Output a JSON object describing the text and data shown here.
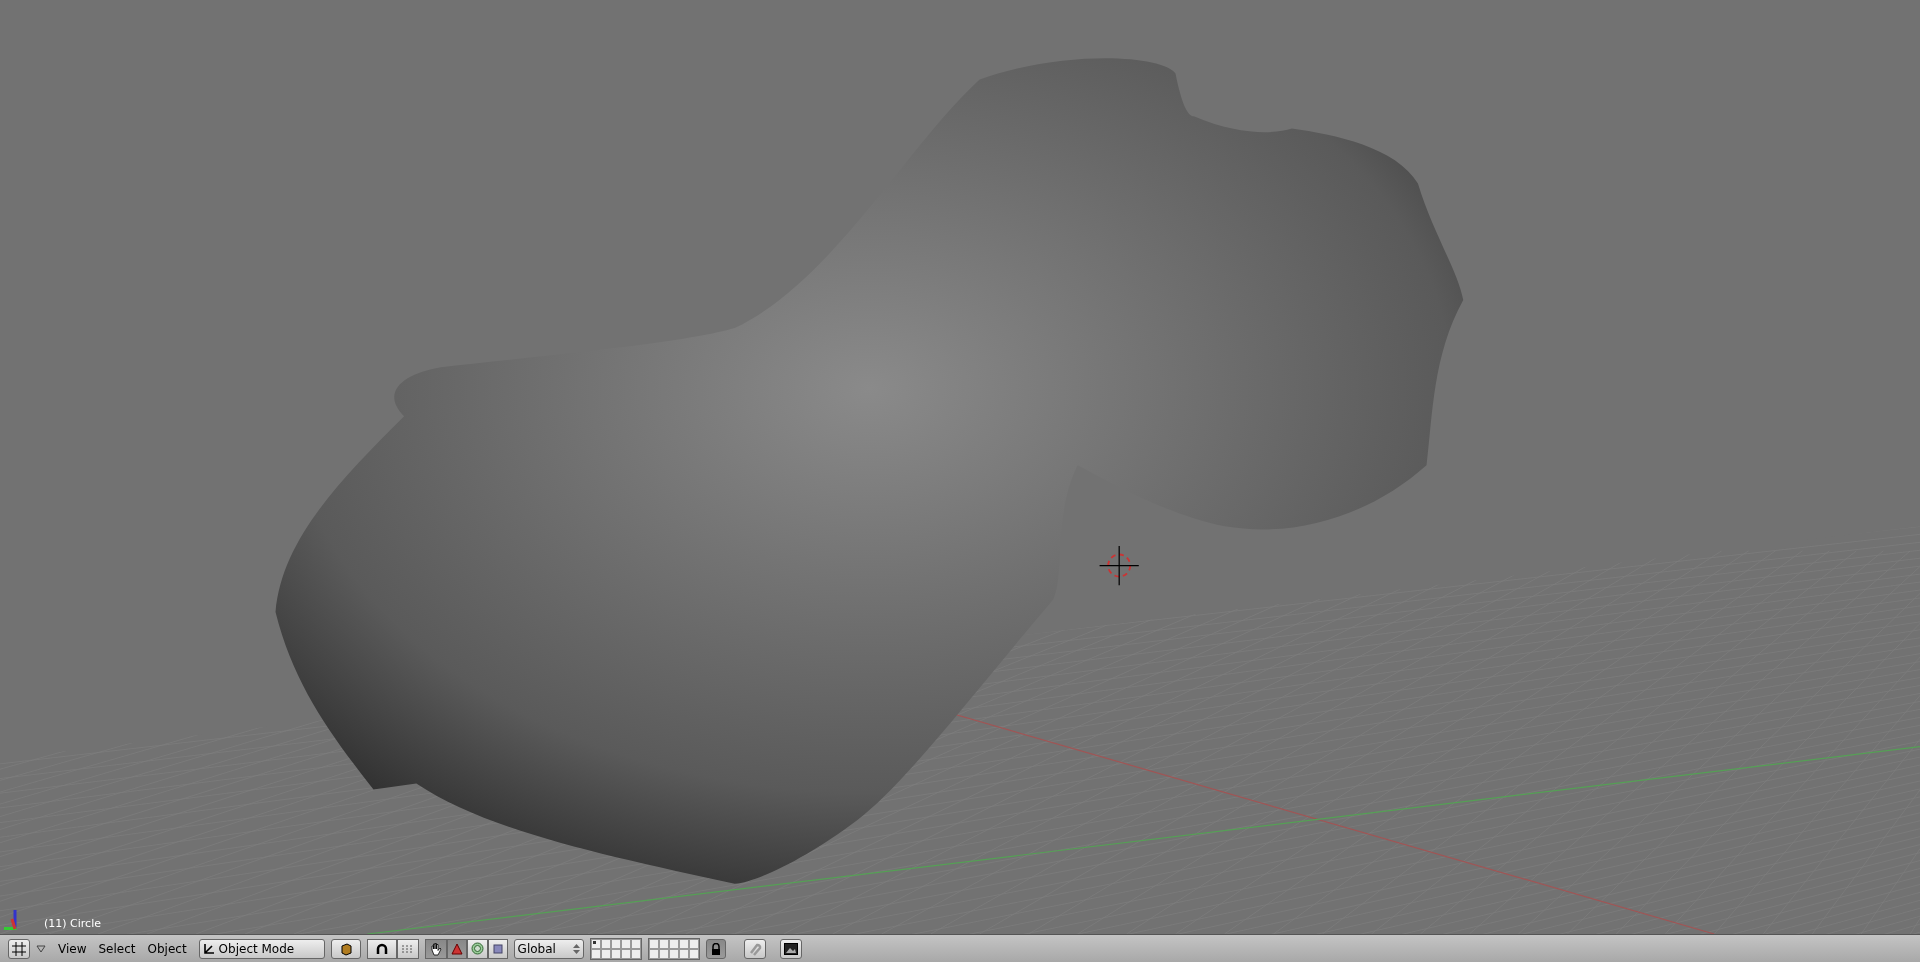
{
  "viewport": {
    "object_label": "(11) Circle"
  },
  "header": {
    "menus": [
      "View",
      "Select",
      "Object"
    ],
    "mode": "Object Mode",
    "manipulators": [
      {
        "kind": "hand",
        "on": true
      },
      {
        "kind": "translate",
        "on": true
      },
      {
        "kind": "rotate",
        "on": false
      },
      {
        "kind": "scale",
        "on": false
      }
    ],
    "orientation": "Global",
    "layers": [
      {
        "has_objects": true
      },
      {
        "has_objects": false
      },
      {
        "has_objects": false
      },
      {
        "has_objects": false
      },
      {
        "has_objects": false
      },
      {
        "has_objects": false
      },
      {
        "has_objects": false
      },
      {
        "has_objects": false
      },
      {
        "has_objects": false
      },
      {
        "has_objects": false
      },
      {
        "has_objects": false
      },
      {
        "has_objects": false
      },
      {
        "has_objects": false
      },
      {
        "has_objects": false
      },
      {
        "has_objects": false
      },
      {
        "has_objects": false
      },
      {
        "has_objects": false
      },
      {
        "has_objects": false
      },
      {
        "has_objects": false
      },
      {
        "has_objects": false
      }
    ],
    "lock_layers": {
      "on": true
    }
  }
}
